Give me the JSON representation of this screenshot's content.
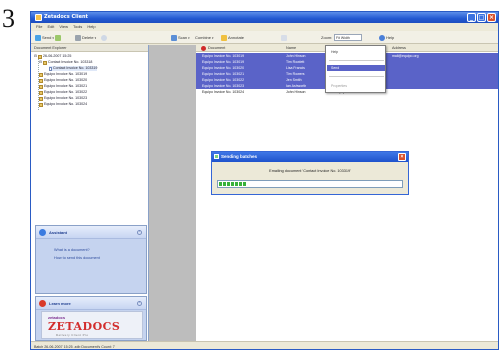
{
  "step_number": "3",
  "window": {
    "title": "Zetadocs Client",
    "buttons": [
      "_",
      "□",
      "×"
    ]
  },
  "menu": [
    "File",
    "Edit",
    "View",
    "Tools",
    "Help"
  ],
  "toolbar": {
    "send_label": "Send",
    "delete_label": "Delete",
    "scan_label": "Scan",
    "combine_label": "Combine",
    "annotate_label": "Annotate",
    "zoom_label": "Zoom:",
    "zoom_value": "Fit Width",
    "help_label": "Help"
  },
  "sidebar": {
    "header": "Document Explorer",
    "tree": [
      {
        "label": "26-06-2007 15:25",
        "level": 0
      },
      {
        "label": "Contact Invoice No. 103318",
        "level": 1
      },
      {
        "label": "Contact Invoice No. 103319",
        "level": 2
      },
      {
        "label": "Equipo Invoice No. 103019",
        "level": 1
      },
      {
        "label": "Equipo Invoice No. 103020",
        "level": 1
      },
      {
        "label": "Equipo Invoice No. 103021",
        "level": 1
      },
      {
        "label": "Equipo Invoice No. 103022",
        "level": 1
      },
      {
        "label": "Equipo Invoice No. 103023",
        "level": 1
      },
      {
        "label": "Equipo Invoice No. 103024",
        "level": 1
      }
    ],
    "assistant": {
      "title": "Assistant",
      "links": [
        "What is a document?",
        "How to send this document"
      ]
    },
    "learn": {
      "title": "Learn more",
      "logo_small": "zetadocs",
      "logo_main": "ZETADOCS",
      "logo_tagline": "Delivery Client Pro"
    }
  },
  "grid": {
    "columns": [
      "Document",
      "Name",
      "Organization",
      "Address"
    ],
    "rows": [
      {
        "doc": "Equipo Invoice No. 103019",
        "name": "John Hinson",
        "org": "Equipo",
        "addr": "mail@equipo.org",
        "selected": true
      },
      {
        "doc": "Equipo Invoice No. 103019",
        "name": "Tim Rowlett",
        "org": "",
        "addr": "",
        "selected": true
      },
      {
        "doc": "Equipo Invoice No. 103020",
        "name": "Lisa Francis",
        "org": "",
        "addr": "",
        "selected": true
      },
      {
        "doc": "Equipo Invoice No. 103021",
        "name": "Tim Rowers",
        "org": "",
        "addr": "",
        "selected": true
      },
      {
        "doc": "Equipo Invoice No. 103022",
        "name": "Jen Smith",
        "org": "",
        "addr": "",
        "selected": true
      },
      {
        "doc": "Equipo Invoice No. 103023",
        "name": "Ian Ashworth",
        "org": "",
        "addr": "",
        "selected": true
      },
      {
        "doc": "Equipo Invoice No. 103024",
        "name": "John Hinson",
        "org": "Equipo",
        "addr": "",
        "selected": false
      }
    ]
  },
  "context_menu": [
    "Help",
    "Send",
    "Properties"
  ],
  "sending_dialog": {
    "title": "Sending batches",
    "message": "Emailing document 'Contact Invoice No. 103319'",
    "progress": 0.16
  },
  "status": "Batch 26-06-2007 15:25 .zdb  Document's Count: 7",
  "colors": {
    "selection": "#5a63c8",
    "titlebar": "#2359d1",
    "sidebar_panel": "#c5d3ef",
    "progress": "#37b13a"
  }
}
